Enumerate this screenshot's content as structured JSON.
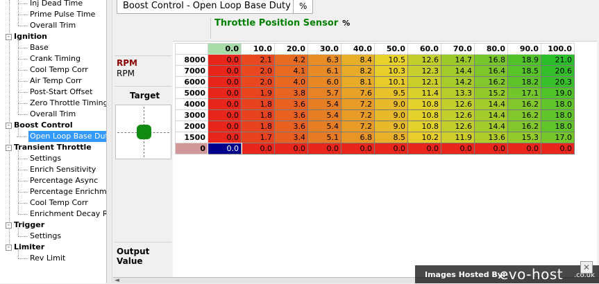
{
  "tree": {
    "items": [
      {
        "label": "Inj Dead Time",
        "type": "child"
      },
      {
        "label": "Prime Pulse Time",
        "type": "child"
      },
      {
        "label": "Overall Trim",
        "type": "child"
      },
      {
        "label": "Ignition",
        "type": "group",
        "expander": "-"
      },
      {
        "label": "Base",
        "type": "child"
      },
      {
        "label": "Crank Timing",
        "type": "child"
      },
      {
        "label": "Cool Temp Corr",
        "type": "child"
      },
      {
        "label": "Air Temp Corr",
        "type": "child"
      },
      {
        "label": "Post-Start Offset",
        "type": "child"
      },
      {
        "label": "Zero Throttle Timing",
        "type": "child"
      },
      {
        "label": "Overall Trim",
        "type": "child"
      },
      {
        "label": "Boost Control",
        "type": "group",
        "expander": "-"
      },
      {
        "label": "Open Loop Base Duty",
        "type": "child",
        "selected": true
      },
      {
        "label": "Transient Throttle",
        "type": "group",
        "expander": "-"
      },
      {
        "label": "Settings",
        "type": "child"
      },
      {
        "label": "Enrich Sensitivity",
        "type": "child"
      },
      {
        "label": "Percentage Async",
        "type": "child"
      },
      {
        "label": "Percentage Enrichment",
        "type": "child"
      },
      {
        "label": "Cool Temp Corr",
        "type": "child"
      },
      {
        "label": "Enrichment Decay Rate",
        "type": "child"
      },
      {
        "label": "Trigger",
        "type": "group",
        "expander": "-"
      },
      {
        "label": "Settings",
        "type": "child"
      },
      {
        "label": "Limiter",
        "type": "group",
        "expander": "-"
      },
      {
        "label": "Rev Limit",
        "type": "child"
      }
    ]
  },
  "tabs": {
    "title": "Boost Control - Open Loop Base Duty",
    "unit": "%"
  },
  "axis_x": {
    "name": "Throttle Position Sensor",
    "unit": "%"
  },
  "axis_y": {
    "name": "RPM",
    "unit": "RPM"
  },
  "target_label": "Target",
  "output_label": "Output Value",
  "table": {
    "columns": [
      "0.0",
      "10.0",
      "20.0",
      "30.0",
      "40.0",
      "50.0",
      "60.0",
      "70.0",
      "80.0",
      "90.0",
      "100.0"
    ],
    "selected_col": 0,
    "rows": [
      {
        "rpm": "8000",
        "values": [
          "0.0",
          "2.1",
          "4.2",
          "6.3",
          "8.4",
          "10.5",
          "12.6",
          "14.7",
          "16.8",
          "18.9",
          "21.0"
        ]
      },
      {
        "rpm": "7000",
        "values": [
          "0.0",
          "2.0",
          "4.1",
          "6.1",
          "8.2",
          "10.3",
          "12.3",
          "14.4",
          "16.4",
          "18.5",
          "20.6"
        ]
      },
      {
        "rpm": "6000",
        "values": [
          "0.0",
          "2.0",
          "4.0",
          "6.0",
          "8.1",
          "10.1",
          "12.1",
          "14.2",
          "16.2",
          "18.2",
          "20.3"
        ]
      },
      {
        "rpm": "5000",
        "values": [
          "0.0",
          "1.9",
          "3.8",
          "5.7",
          "7.6",
          "9.5",
          "11.4",
          "13.3",
          "15.2",
          "17.1",
          "19.0"
        ]
      },
      {
        "rpm": "4000",
        "values": [
          "0.0",
          "1.8",
          "3.6",
          "5.4",
          "7.2",
          "9.0",
          "10.8",
          "12.6",
          "14.4",
          "16.2",
          "18.0"
        ]
      },
      {
        "rpm": "3000",
        "values": [
          "0.0",
          "1.8",
          "3.6",
          "5.4",
          "7.2",
          "9.0",
          "10.8",
          "12.6",
          "14.4",
          "16.2",
          "18.0"
        ]
      },
      {
        "rpm": "2000",
        "values": [
          "0.0",
          "1.8",
          "3.6",
          "5.4",
          "7.2",
          "9.0",
          "10.8",
          "12.6",
          "14.4",
          "16.2",
          "18.0"
        ]
      },
      {
        "rpm": "1500",
        "values": [
          "0.0",
          "1.7",
          "3.4",
          "5.1",
          "6.8",
          "8.5",
          "10.2",
          "11.9",
          "13.6",
          "15.3",
          "17.0"
        ]
      },
      {
        "rpm": "0",
        "values": [
          "0.0",
          "0.0",
          "0.0",
          "0.0",
          "0.0",
          "0.0",
          "0.0",
          "0.0",
          "0.0",
          "0.0",
          "0.0"
        ],
        "selected": true
      }
    ],
    "active_cell": {
      "row": 8,
      "col": 0
    },
    "colors": {
      "min": "#e8261c",
      "mid": "#e8d22c",
      "max": "#2cbe2a",
      "active_cell": "#00008b"
    },
    "value_range": [
      0,
      21.0
    ]
  },
  "watermark": {
    "hosted_by": "Images Hosted By:",
    "logo": "evo-host",
    "domain": ".co.uk",
    "close_glyph": "✕"
  }
}
